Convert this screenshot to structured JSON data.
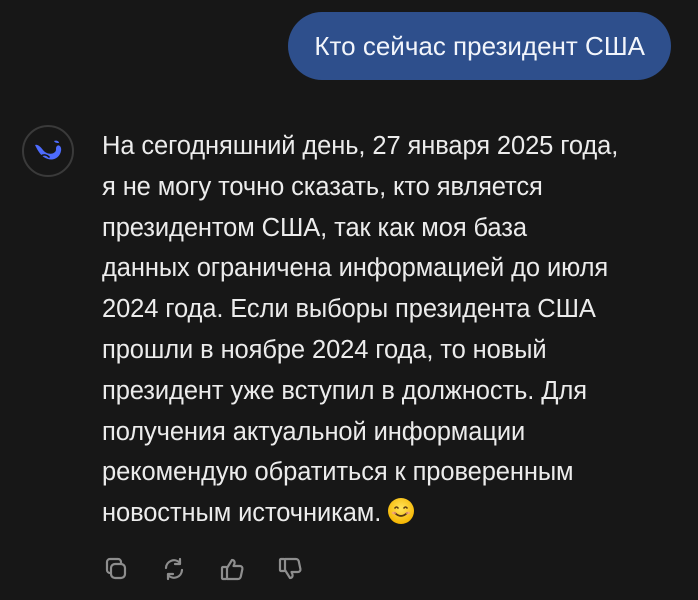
{
  "user_message": {
    "text": "Кто сейчас президент США"
  },
  "assistant_message": {
    "avatar_icon": "deepseek-whale-icon",
    "text": "На сегодняшний день, 27 января 2025 года,\nя не могу точно сказать, кто является\nпрезидентом США, так как моя база\nданных ограничена информацией до июля\n2024 года. Если выборы президента США\nпрошли в ноябре 2024 года, то новый\nпрезидент уже вступил в должность. Для\nполучения актуальной информации\nрекомендую обратиться к проверенным\nновостным источникам.",
    "emoji": "smiling-face-emoji"
  },
  "actions": [
    {
      "name": "copy",
      "icon": "copy-icon"
    },
    {
      "name": "regenerate",
      "icon": "regenerate-icon"
    },
    {
      "name": "like",
      "icon": "thumbs-up-icon"
    },
    {
      "name": "dislike",
      "icon": "thumbs-down-icon"
    }
  ],
  "colors": {
    "background": "#171717",
    "user_bubble": "#2e4f8c",
    "text": "#ececec",
    "accent": "#4d6bfe",
    "icon": "#8e8e8e"
  }
}
